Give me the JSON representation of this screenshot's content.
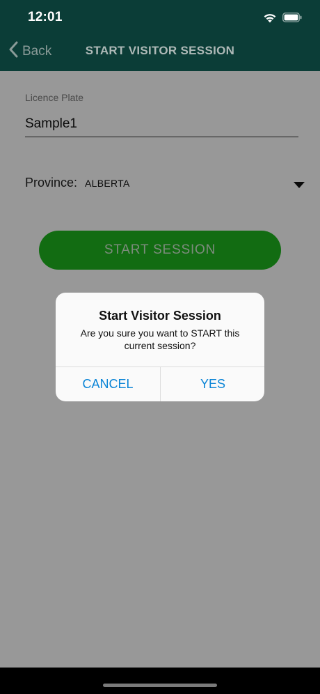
{
  "status_bar": {
    "time": "12:01"
  },
  "nav": {
    "back_label": "Back",
    "title": "START VISITOR SESSION"
  },
  "form": {
    "licence_plate_label": "Licence Plate",
    "licence_plate_value": "Sample1",
    "province_label": "Province:",
    "province_value": "ALBERTA",
    "start_button_label": "START SESSION"
  },
  "alert": {
    "title": "Start Visitor Session",
    "message": "Are you sure you want to START this current session?",
    "cancel_label": "CANCEL",
    "yes_label": "YES"
  },
  "colors": {
    "header_bg": "#0b3d37",
    "start_button": "#1fb51f",
    "alert_button_text": "#0a84d6"
  },
  "icons": {
    "back": "chevron-left-icon",
    "dropdown": "triangle-down-icon",
    "wifi": "wifi-icon",
    "battery": "battery-icon"
  }
}
